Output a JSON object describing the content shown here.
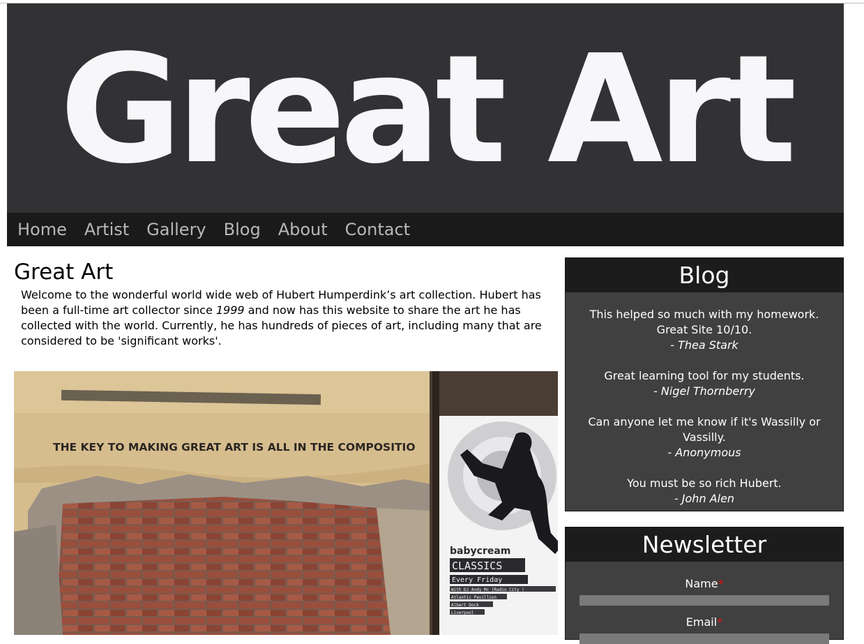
{
  "header": {
    "title": "Great Art"
  },
  "nav": {
    "items": [
      {
        "label": "Home"
      },
      {
        "label": "Artist"
      },
      {
        "label": "Gallery"
      },
      {
        "label": "Blog"
      },
      {
        "label": "About"
      },
      {
        "label": "Contact"
      }
    ]
  },
  "main": {
    "title": "Great Art",
    "intro_part1": "Welcome to the wonderful world wide web of Hubert Humperdink’s art collection. Hubert has been a full-time art collector since ",
    "intro_year": "1999",
    "intro_part2": " and now has this website to share the art he has collected with the world. Currently, he has hundreds of pieces of art, including many that are considered to be 'significant works'.",
    "image": {
      "stencil_text": "THE KEY TO MAKING GREAT ART IS ALL IN THE COMPOSITIO",
      "poster_brand": "babycream",
      "poster_title": "CLASSICS",
      "poster_sub": "Every Friday",
      "poster_lines": [
        "With DJ Andy Mc (Radio City )",
        "Atlantic Pavillion",
        "Albert Dock",
        "Liverpool"
      ]
    }
  },
  "blog": {
    "title": "Blog",
    "comments": [
      {
        "text": "This helped so much with my homework. Great Site 10/10.",
        "author": "- Thea Stark"
      },
      {
        "text": "Great learning tool for my students.",
        "author": "- Nigel Thornberry"
      },
      {
        "text": "Can anyone let me know if it's Wassilly or Vassilly.",
        "author": "- Anonymous"
      },
      {
        "text": "You must be so rich Hubert.",
        "author": "- John Alen"
      }
    ]
  },
  "newsletter": {
    "title": "Newsletter",
    "name_label": "Name",
    "email_label": "Email",
    "required_mark": "*"
  },
  "colors": {
    "header_bg": "#323234",
    "nav_bg": "#1a1a1a",
    "panel_bg": "#404040",
    "panel_head_bg": "#1c1c1c",
    "required": "#e01010"
  }
}
